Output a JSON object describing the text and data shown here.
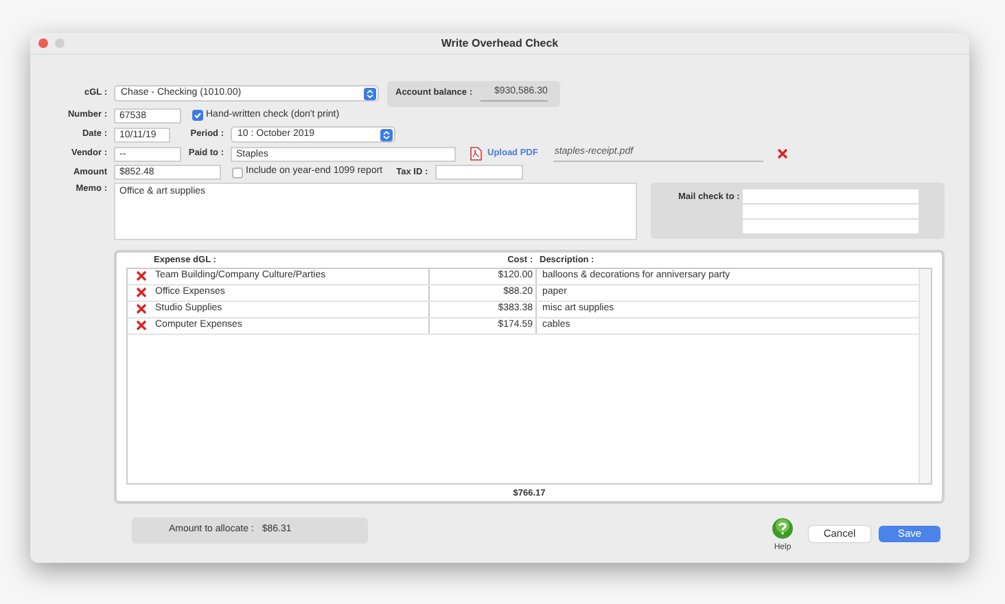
{
  "window": {
    "title": "Write Overhead Check"
  },
  "cgl": {
    "label": "cGL :",
    "value": "Chase - Checking (1010.00)"
  },
  "account_balance": {
    "label": "Account balance :",
    "value": "$930,586.30"
  },
  "number": {
    "label": "Number :",
    "value": "67538"
  },
  "handwritten": {
    "label": "Hand-written check (don't print)",
    "checked": true
  },
  "date": {
    "label": "Date :",
    "value": "10/11/19"
  },
  "period": {
    "label": "Period :",
    "value": "10 : October 2019"
  },
  "vendor": {
    "label": "Vendor :",
    "value": "--"
  },
  "paid_to": {
    "label": "Paid to :",
    "value": "Staples"
  },
  "upload": {
    "label": "Upload PDF",
    "file": "staples-receipt.pdf"
  },
  "amount": {
    "label": "Amount",
    "value": "$852.48"
  },
  "include_1099": {
    "label": "Include on year-end 1099 report",
    "checked": false
  },
  "tax_id": {
    "label": "Tax ID :"
  },
  "memo": {
    "label": "Memo :",
    "value": "Office & art supplies"
  },
  "mail_check": {
    "label": "Mail check to :"
  },
  "table": {
    "columns": [
      "Expense dGL :",
      "Cost :",
      "Description :"
    ],
    "rows": [
      {
        "account": "Team Building/Company Culture/Parties",
        "cost": "$120.00",
        "description": "balloons & decorations for anniversary party"
      },
      {
        "account": "Office Expenses",
        "cost": "$88.20",
        "description": "paper"
      },
      {
        "account": "Studio Supplies",
        "cost": "$383.38",
        "description": "misc art supplies"
      },
      {
        "account": "Computer Expenses",
        "cost": "$174.59",
        "description": "cables"
      }
    ],
    "total": "$766.17"
  },
  "allocate": {
    "label": "Amount to allocate :",
    "value": "$86.31"
  },
  "help": {
    "label": "Help"
  },
  "buttons": {
    "cancel": "Cancel",
    "save": "Save"
  }
}
